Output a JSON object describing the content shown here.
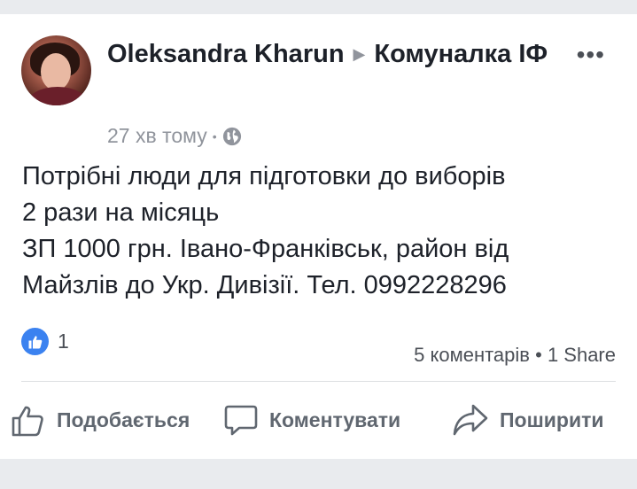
{
  "post": {
    "author": "Oleksandra Kharun",
    "group": "Комуналка ІФ",
    "time": "27 хв тому",
    "privacy_icon": "globe-icon",
    "text_lines": [
      "Потрібні люди для підготовки до виборів",
      "2 рази на місяць",
      "ЗП 1000 грн. Івано-Франківськ, район від",
      "Майзлів до Укр. Дивізії. Тел. 0992228296"
    ]
  },
  "reactions": {
    "like_count": "1",
    "comments": "5 коментарів",
    "shares": "1 Share"
  },
  "actions": {
    "like": "Подобається",
    "comment": "Коментувати",
    "share": "Поширити"
  },
  "colors": {
    "like_blue": "#3b82f0",
    "text": "#1d2129",
    "meta": "#90949c"
  }
}
